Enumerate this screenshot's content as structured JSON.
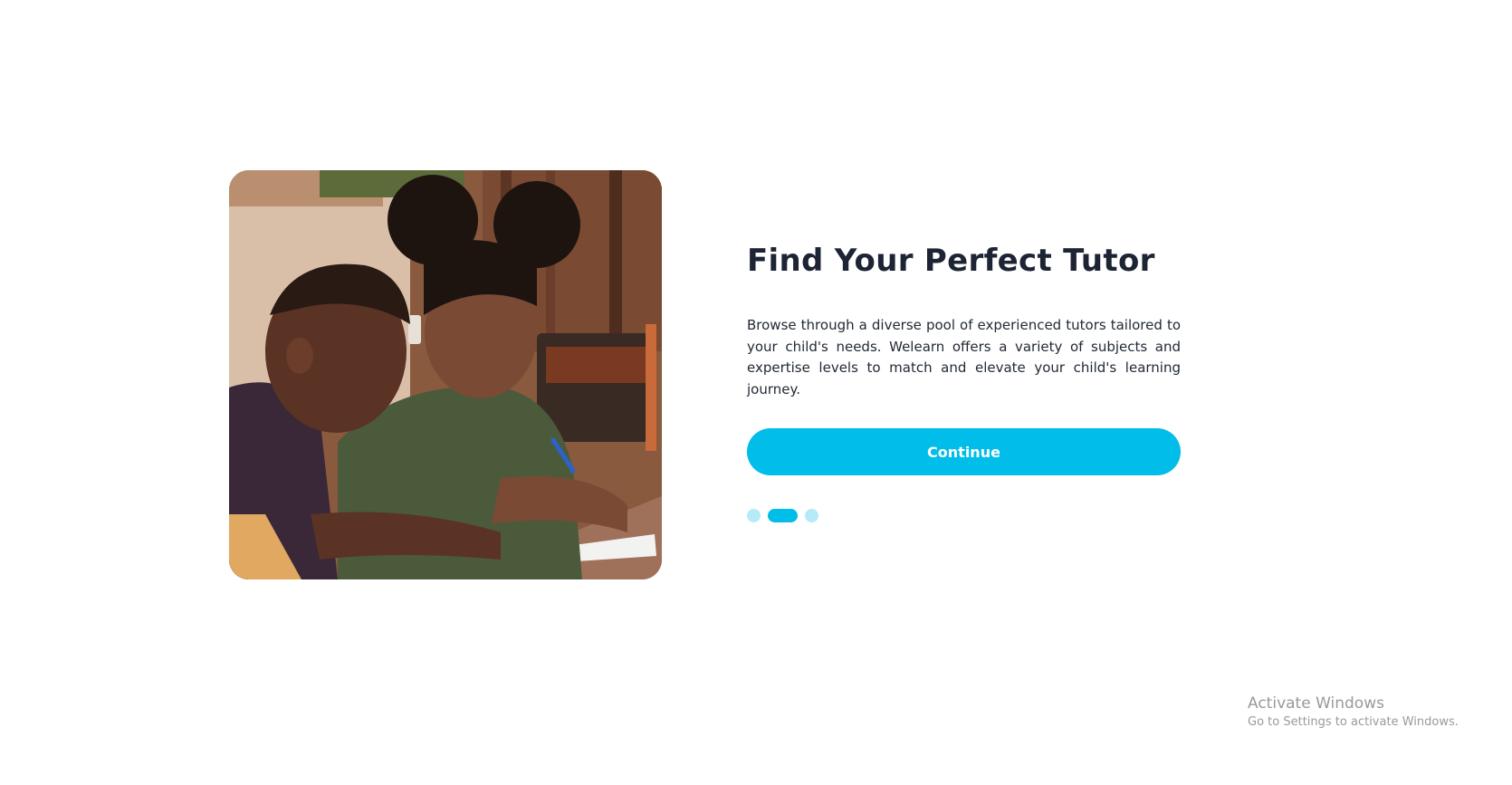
{
  "onboarding": {
    "title": "Find Your Perfect Tutor",
    "description": "Browse through a diverse pool of experienced tutors tailored to your child's needs. Welearn offers a variety of subjects and expertise levels to match and elevate your child's learning journey.",
    "continue_label": "Continue",
    "slides_total": 3,
    "active_slide": 2
  },
  "colors": {
    "accent": "#00bde9",
    "accent_light": "#b5ebf8",
    "title": "#1d2433",
    "text": "#222a36",
    "background": "#ffffff"
  },
  "os_watermark": {
    "title": "Activate Windows",
    "subtitle": "Go to Settings to activate Windows."
  }
}
